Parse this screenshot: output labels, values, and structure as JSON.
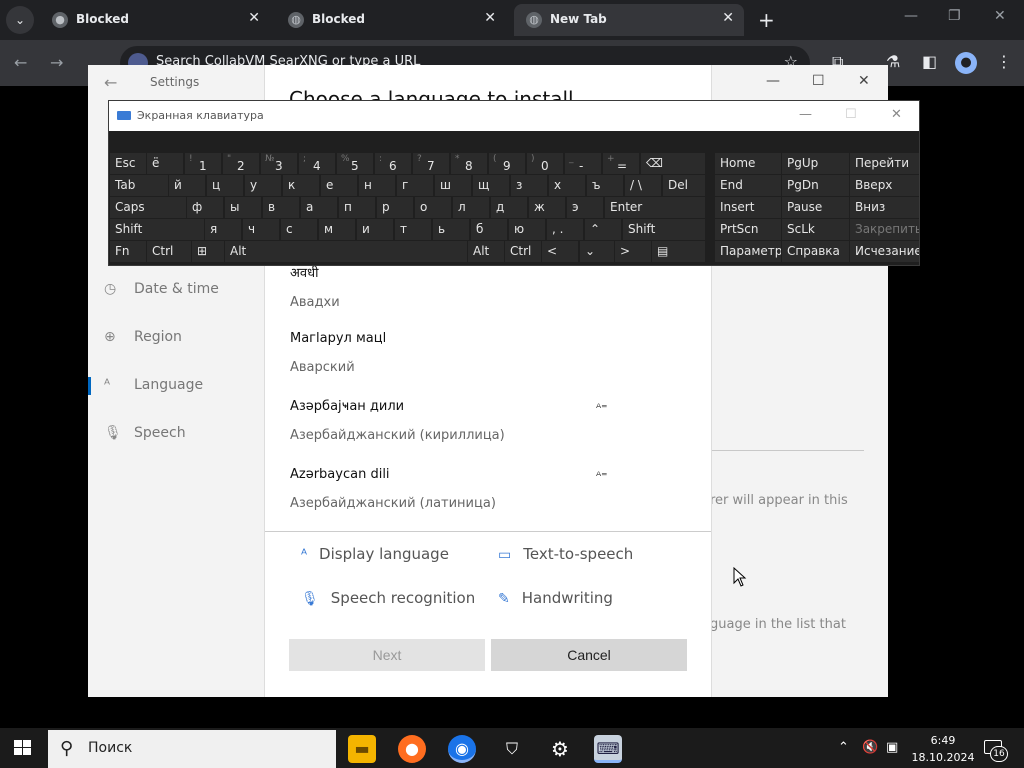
{
  "browser": {
    "tabs": [
      {
        "label": "Blocked",
        "active": false
      },
      {
        "label": "Blocked",
        "active": false
      },
      {
        "label": "New Tab",
        "active": true
      }
    ],
    "omnibox_placeholder": "Search CollabVM SearXNG or type a URL"
  },
  "settings": {
    "window_title": "Settings",
    "nav": [
      {
        "label": "Date & time",
        "icon": "clock-icon"
      },
      {
        "label": "Region",
        "icon": "globe-icon"
      },
      {
        "label": "Language",
        "icon": "language-icon",
        "selected": true
      },
      {
        "label": "Speech",
        "icon": "microphone-icon"
      }
    ],
    "right_text_1": "rer will appear in this",
    "right_text_2": "guage in the list that"
  },
  "dialog": {
    "title": "Choose a language to install",
    "languages": [
      {
        "native": "अवधी",
        "localized": "Авадхи",
        "display_lang": false
      },
      {
        "native": "Магlарул мацl",
        "localized": "Аварский",
        "display_lang": false
      },
      {
        "native": "Азәрбајҹан дили",
        "localized": "Азербайджанский (кириллица)",
        "display_lang": true
      },
      {
        "native": "Azərbaycan dili",
        "localized": "Азербайджанский (латиница)",
        "display_lang": true
      }
    ],
    "features": {
      "display_language": "Display language",
      "text_to_speech": "Text-to-speech",
      "speech_recognition": "Speech recognition",
      "handwriting": "Handwriting"
    },
    "buttons": {
      "next": "Next",
      "cancel": "Cancel"
    }
  },
  "osk": {
    "title": "Экранная клавиатура",
    "row1": [
      {
        "m": "Esc"
      },
      {
        "m": "ё"
      },
      {
        "s": "!",
        "m": "1"
      },
      {
        "s": "\"",
        "m": "2"
      },
      {
        "s": "№",
        "m": "3"
      },
      {
        "s": ";",
        "m": "4"
      },
      {
        "s": "%",
        "m": "5"
      },
      {
        "s": ":",
        "m": "6"
      },
      {
        "s": "?",
        "m": "7"
      },
      {
        "s": "*",
        "m": "8"
      },
      {
        "s": "(",
        "m": "9"
      },
      {
        "s": ")",
        "m": "0"
      },
      {
        "s": "_",
        "m": "-"
      },
      {
        "s": "+",
        "m": "="
      },
      {
        "m": "⌫"
      }
    ],
    "row2": [
      "Tab",
      "й",
      "ц",
      "у",
      "к",
      "е",
      "н",
      "г",
      "ш",
      "щ",
      "з",
      "х",
      "ъ",
      "/ \\",
      "Del"
    ],
    "row3": [
      "Caps",
      "ф",
      "ы",
      "в",
      "а",
      "п",
      "р",
      "о",
      "л",
      "д",
      "ж",
      "э",
      "Enter"
    ],
    "row4": [
      "Shift",
      "я",
      "ч",
      "с",
      "м",
      "и",
      "т",
      "ь",
      "б",
      "ю",
      ", .",
      "⌃",
      "Shift"
    ],
    "row5": [
      "Fn",
      "Ctrl",
      "⊞",
      "Alt",
      "Alt",
      "Ctrl",
      "<",
      "⌄",
      ">",
      "▤"
    ],
    "nav_keys": [
      [
        "Home",
        "PgUp",
        "Перейти"
      ],
      [
        "End",
        "PgDn",
        "Вверх"
      ],
      [
        "Insert",
        "Pause",
        "Вниз"
      ],
      [
        "PrtScn",
        "ScLk",
        "Закрепить"
      ],
      [
        "Параметры",
        "Справка",
        "Исчезание"
      ]
    ]
  },
  "taskbar": {
    "search_placeholder": "Поиск",
    "time": "6:49",
    "date": "18.10.2024",
    "notification_count": "16"
  }
}
